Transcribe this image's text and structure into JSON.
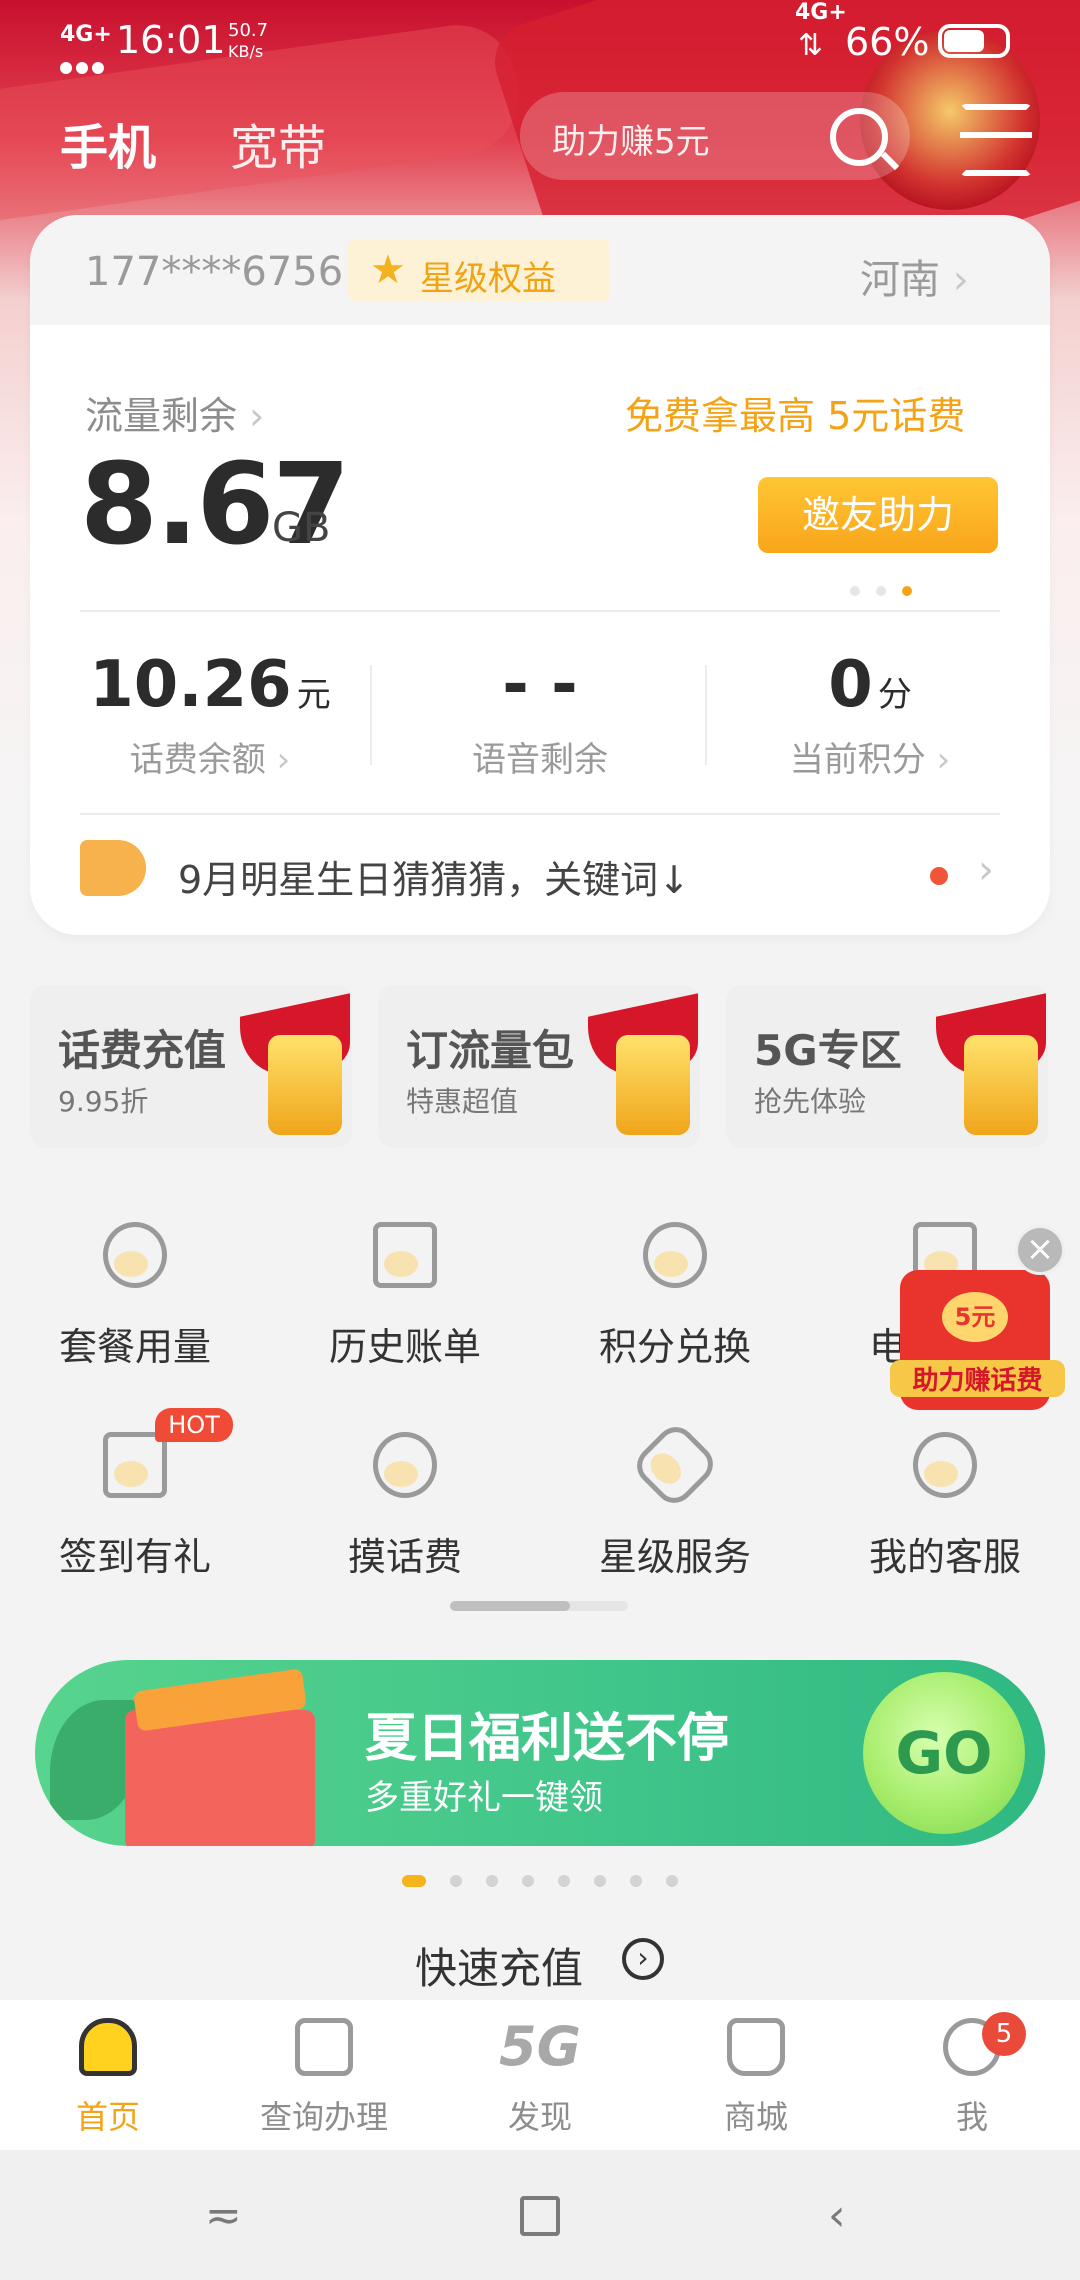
{
  "status_bar": {
    "network_left": "4G+",
    "time": "16:01",
    "speed": "50.7",
    "speed_unit": "KB/s",
    "network_right": "4G+",
    "battery": "66%"
  },
  "header": {
    "tabs": [
      "手机",
      "宽带"
    ],
    "search_placeholder": "助力赚5元"
  },
  "account": {
    "phone": "177****6756",
    "star_badge": "星级权益",
    "region": "河南",
    "flow_label": "流量剩余",
    "flow_value": "8.67",
    "flow_unit": "GB",
    "promo": "免费拿最高 5元话费",
    "invite_button": "邀友助力",
    "stats": [
      {
        "value": "10.26",
        "unit": "元",
        "label": "话费余额"
      },
      {
        "value": "- -",
        "unit": "",
        "label": "语音剩余"
      },
      {
        "value": "0",
        "unit": "分",
        "label": "当前积分"
      }
    ],
    "notice": "9月明星生日猜猜猜，关键词↓"
  },
  "promo_tiles": [
    {
      "title": "话费充值",
      "subtitle": "9.95折"
    },
    {
      "title": "订流量包",
      "subtitle": "特惠超值"
    },
    {
      "title": "5G专区",
      "subtitle": "抢先体验"
    }
  ],
  "grid": [
    {
      "label": "套餐用量",
      "icon": "pie-chart-icon"
    },
    {
      "label": "历史账单",
      "icon": "clipboard-icon"
    },
    {
      "label": "积分兑换",
      "icon": "coins-icon"
    },
    {
      "label": "电子发票",
      "icon": "invoice-icon"
    },
    {
      "label": "签到有礼",
      "icon": "calendar-check-icon"
    },
    {
      "label": "摸话费",
      "icon": "yuan-coin-icon"
    },
    {
      "label": "星级服务",
      "icon": "star-icon"
    },
    {
      "label": "我的客服",
      "icon": "headset-icon"
    }
  ],
  "hot_badge": "HOT",
  "floating": {
    "amount": "5元",
    "text": "助力赚话费"
  },
  "banner": {
    "title": "夏日福利送不停",
    "subtitle": "多重好礼一键领",
    "go": "GO"
  },
  "quick_recharge": "快速充值",
  "bottom_nav": [
    {
      "label": "首页",
      "active": true
    },
    {
      "label": "查询办理",
      "active": false
    },
    {
      "label": "发现",
      "active": false
    },
    {
      "label": "商城",
      "active": false
    },
    {
      "label": "我",
      "active": false,
      "badge": "5"
    }
  ],
  "colors": {
    "brand_red": "#c8102e",
    "accent_orange": "#f5a316",
    "banner_green": "#3fc48a"
  }
}
